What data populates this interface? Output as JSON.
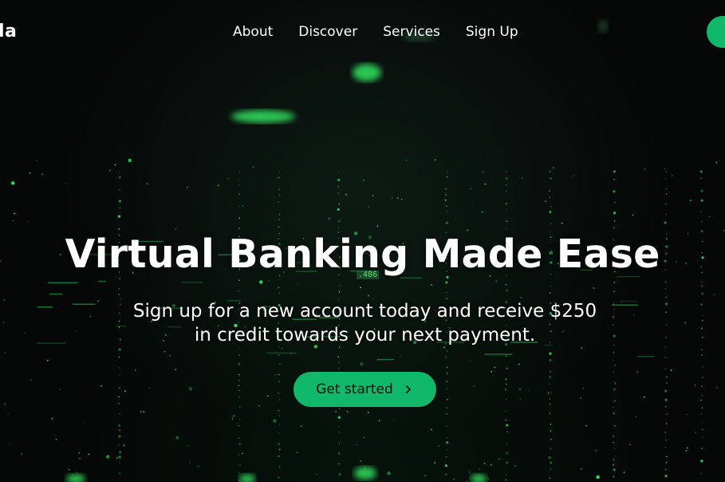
{
  "nav": {
    "logo_text": "la",
    "items": [
      {
        "label": "About"
      },
      {
        "label": "Discover"
      },
      {
        "label": "Services"
      },
      {
        "label": "Sign Up"
      }
    ]
  },
  "hero": {
    "title": "Virtual Banking Made Ease",
    "subtitle_line1": "Sign up for a new account today and receive $250",
    "subtitle_line2": "in credit towards your next payment.",
    "cta_label": "Get started",
    "cta_icon": "chevron-right-icon",
    "bg_code_text": ".486"
  },
  "colors": {
    "accent": "#12b86a",
    "glow": "#39ff6a",
    "background": "#050807"
  }
}
